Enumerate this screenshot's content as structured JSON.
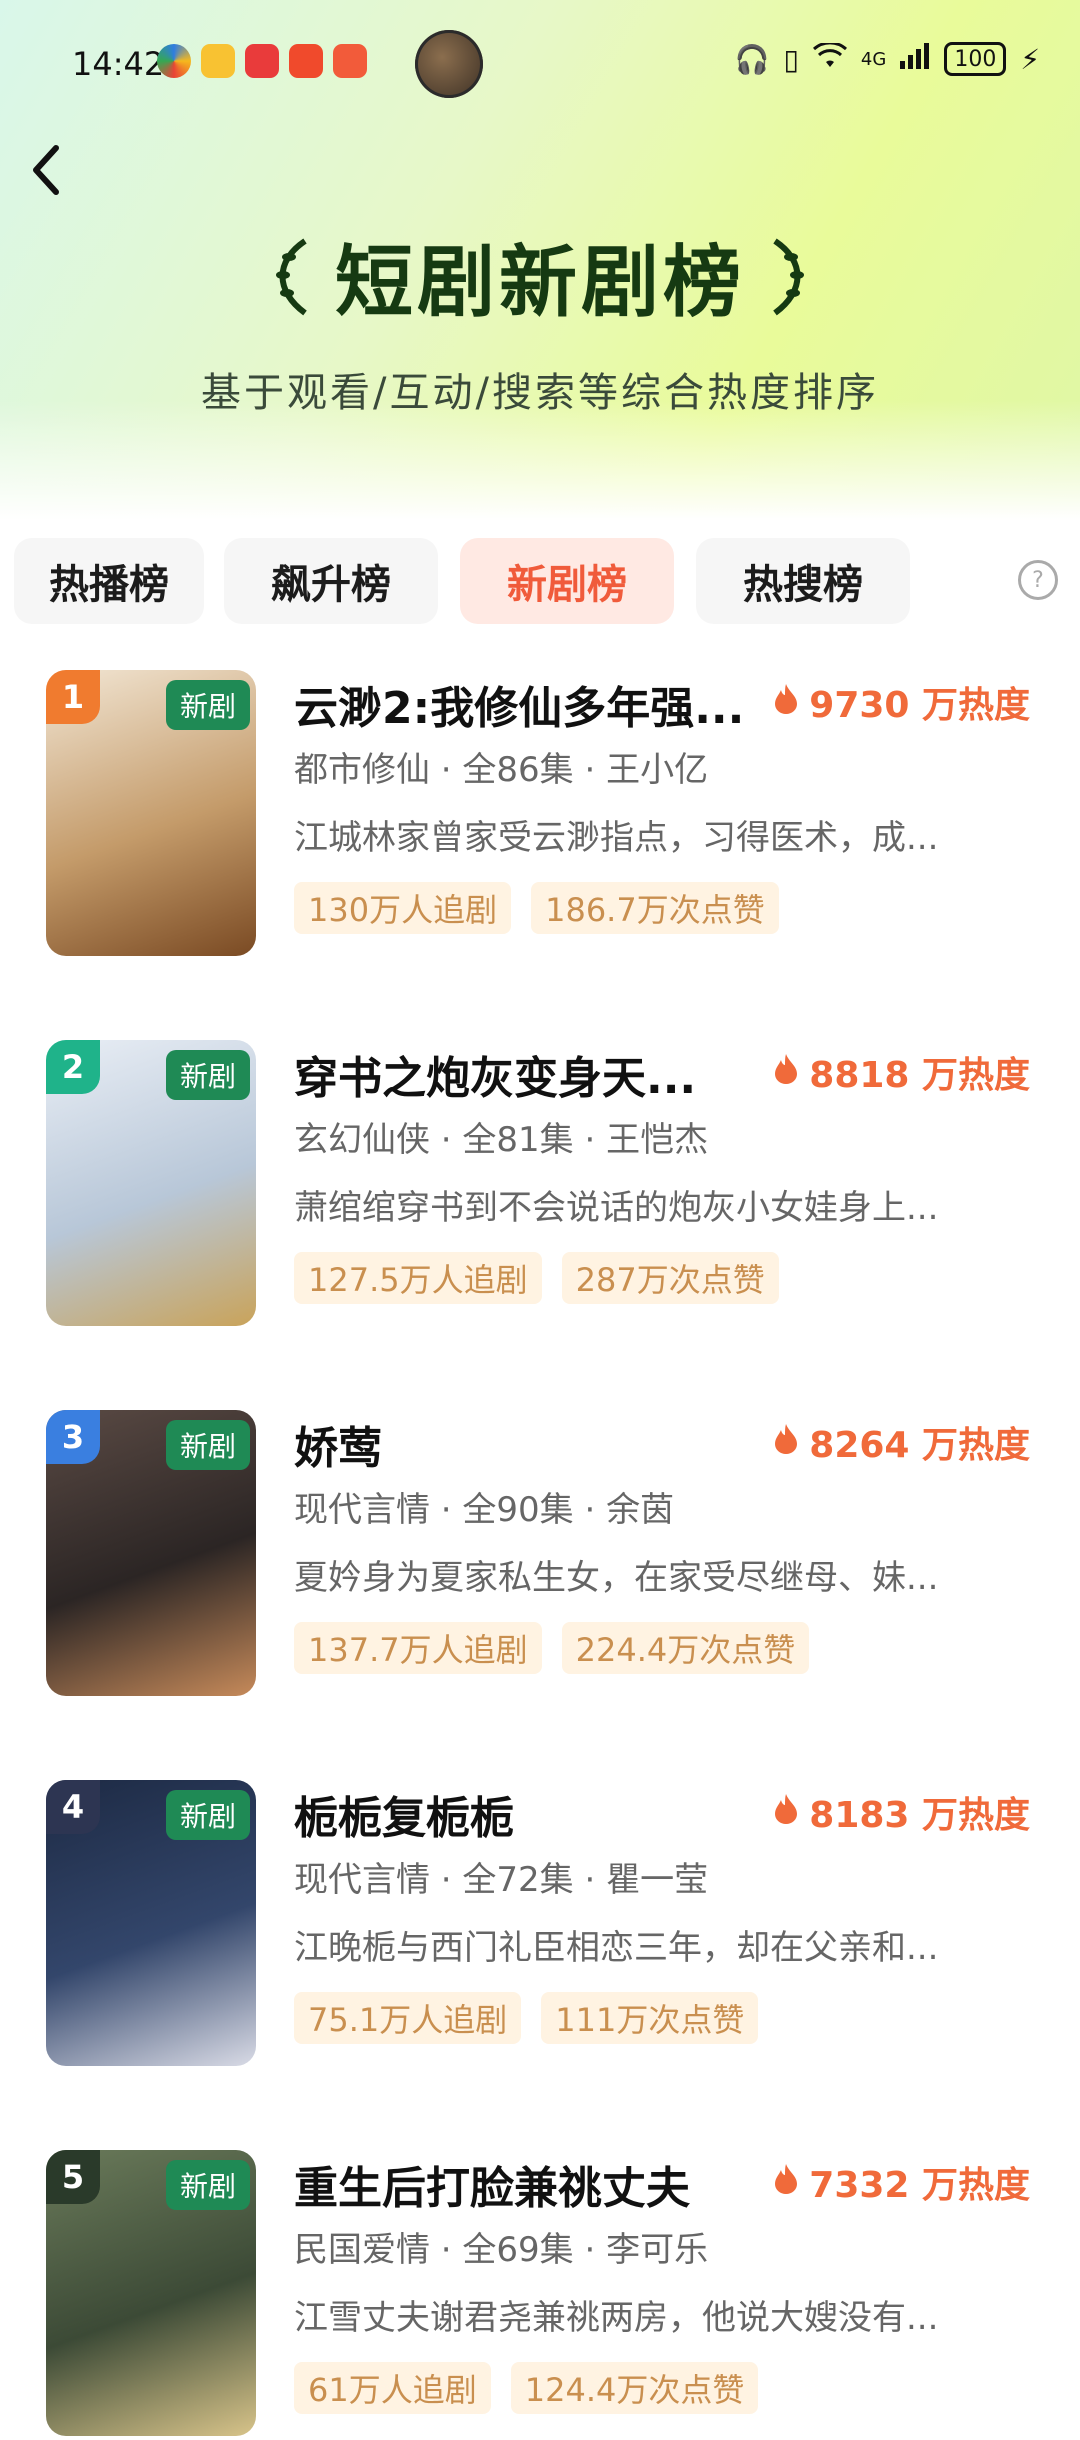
{
  "status_bar": {
    "time": "14:42",
    "battery": "100",
    "network": "4G"
  },
  "header": {
    "title": "短剧新剧榜",
    "subtitle": "基于观看/互动/搜索等综合热度排序"
  },
  "tabs": [
    {
      "label": "热播榜",
      "active": false
    },
    {
      "label": "飙升榜",
      "active": false
    },
    {
      "label": "新剧榜",
      "active": true
    },
    {
      "label": "热搜榜",
      "active": false
    }
  ],
  "items": [
    {
      "rank": "1",
      "tag": "新剧",
      "title": "云渺2:我修仙多年强...",
      "heat": "9730 万热度",
      "meta": "都市修仙 · 全86集 · 王小亿",
      "desc": "江城林家曾家受云渺指点，习得医术，成...",
      "followers": "130万人追剧",
      "likes": "186.7万次点赞",
      "rank_color": "#f07b2f",
      "poster_colors": [
        "#f2e6d4",
        "#c49b6a",
        "#7a4a23"
      ]
    },
    {
      "rank": "2",
      "tag": "新剧",
      "title": "穿书之炮灰变身天...",
      "heat": "8818 万热度",
      "meta": "玄幻仙侠 · 全81集 · 王恺杰",
      "desc": "萧绾绾穿书到不会说话的炮灰小女娃身上...",
      "followers": "127.5万人追剧",
      "likes": "287万次点赞",
      "rank_color": "#1fb38a",
      "poster_colors": [
        "#e9eef5",
        "#b8c7d8",
        "#c9a35a"
      ]
    },
    {
      "rank": "3",
      "tag": "新剧",
      "title": "娇莺",
      "heat": "8264 万热度",
      "meta": "现代言情 · 全90集 · 余茵",
      "desc": "夏妗身为夏家私生女，在家受尽继母、妹...",
      "followers": "137.7万人追剧",
      "likes": "224.4万次点赞",
      "rank_color": "#3a7fe0",
      "poster_colors": [
        "#5a4a44",
        "#2b2524",
        "#c68a5a"
      ]
    },
    {
      "rank": "4",
      "tag": "新剧",
      "title": "栀栀复栀栀",
      "heat": "8183 万热度",
      "meta": "现代言情 · 全72集 · 瞿一莹",
      "desc": "江晚栀与西门礼臣相恋三年，却在父亲和...",
      "followers": "75.1万人追剧",
      "likes": "111万次点赞",
      "rank_color": "#2d3552",
      "poster_colors": [
        "#1d2a44",
        "#33466b",
        "#d9dbe6"
      ]
    },
    {
      "rank": "5",
      "tag": "新剧",
      "title": "重生后打脸兼祧丈夫",
      "heat": "7332 万热度",
      "meta": "民国爱情 · 全69集 · 李可乐",
      "desc": "江雪丈夫谢君尧兼祧两房，他说大嫂没有...",
      "followers": "61万人追剧",
      "likes": "124.4万次点赞",
      "rank_color": "#2a3a2a",
      "poster_colors": [
        "#6a7a5a",
        "#3c4a36",
        "#d8c48a"
      ]
    }
  ]
}
